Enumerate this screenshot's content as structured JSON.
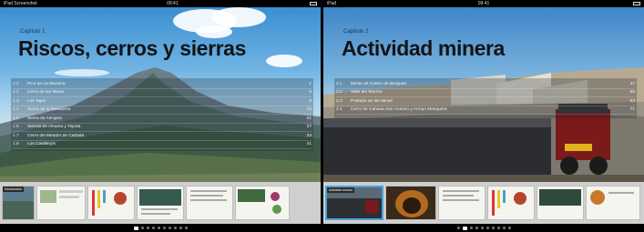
{
  "left": {
    "status": {
      "carrier": "iPad Screenshot",
      "time": "09:41"
    },
    "chapter_label": "Capítulo 1",
    "chapter_title": "Riscos, cerros y sierras",
    "toc": [
      {
        "num": "1.1",
        "text": "Pico de La Maroma",
        "page": "1"
      },
      {
        "num": "1.2",
        "text": "Cerro de las Minas",
        "page": "5"
      },
      {
        "num": "1.3",
        "text": "Los Tajos",
        "page": "9"
      },
      {
        "num": "1.4",
        "text": "Sierra de la Mosquera",
        "page": "15"
      },
      {
        "num": "1.5",
        "text": "Sierra de Almijara",
        "page": "21"
      },
      {
        "num": "1.6",
        "text": "Sierras de Alhama y Tejeda",
        "page": "27"
      },
      {
        "num": "1.7",
        "text": "Cerro del Mirador de Cañada",
        "page": "33"
      },
      {
        "num": "1.8",
        "text": "Los Castillejos",
        "page": "41"
      }
    ],
    "thumb_label": "Introducción"
  },
  "right": {
    "status": {
      "carrier": "iPad",
      "time": "09:41"
    },
    "chapter_label": "Capítulo 2",
    "chapter_title": "Actividad minera",
    "toc": [
      {
        "num": "2.1",
        "text": "Minas de Castro de Bergudo",
        "page": "47"
      },
      {
        "num": "2.2",
        "text": "Valle del Morrón",
        "page": "55"
      },
      {
        "num": "2.3",
        "text": "Poblado de las Minas",
        "page": "63"
      },
      {
        "num": "2.4",
        "text": "Cerro de Cañada San Antonio y Arroyo Mosquera",
        "page": "71"
      }
    ],
    "thumb_label": "Actividad minera"
  },
  "pager": {
    "left_count": 10,
    "left_active": 0,
    "right_count": 10,
    "right_active": 1
  },
  "colors": {
    "title": "#141414",
    "strip": "#cfcfcf",
    "sky": "#3b8fd0"
  }
}
